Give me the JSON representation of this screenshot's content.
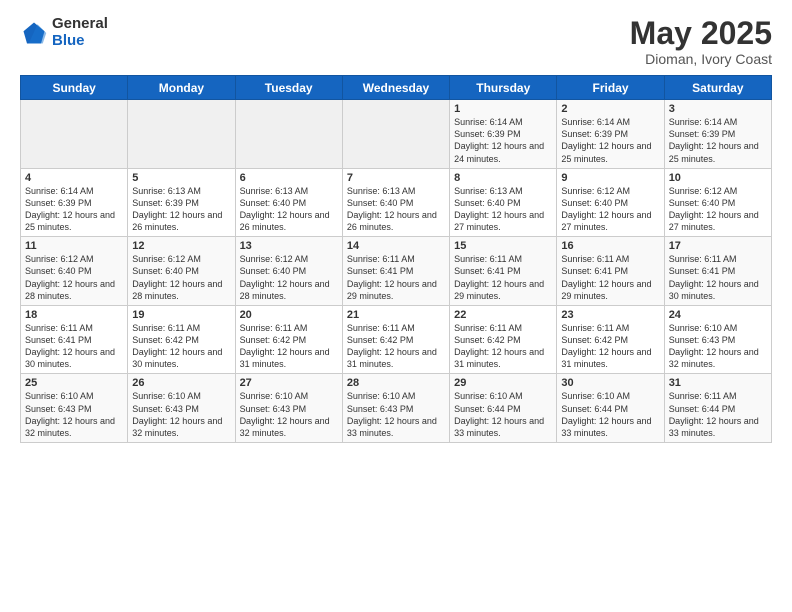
{
  "logo": {
    "general": "General",
    "blue": "Blue"
  },
  "title": "May 2025",
  "location": "Dioman, Ivory Coast",
  "days_header": [
    "Sunday",
    "Monday",
    "Tuesday",
    "Wednesday",
    "Thursday",
    "Friday",
    "Saturday"
  ],
  "weeks": [
    [
      {
        "day": "",
        "info": ""
      },
      {
        "day": "",
        "info": ""
      },
      {
        "day": "",
        "info": ""
      },
      {
        "day": "",
        "info": ""
      },
      {
        "day": "1",
        "info": "Sunrise: 6:14 AM\nSunset: 6:39 PM\nDaylight: 12 hours and 24 minutes."
      },
      {
        "day": "2",
        "info": "Sunrise: 6:14 AM\nSunset: 6:39 PM\nDaylight: 12 hours and 25 minutes."
      },
      {
        "day": "3",
        "info": "Sunrise: 6:14 AM\nSunset: 6:39 PM\nDaylight: 12 hours and 25 minutes."
      }
    ],
    [
      {
        "day": "4",
        "info": "Sunrise: 6:14 AM\nSunset: 6:39 PM\nDaylight: 12 hours and 25 minutes."
      },
      {
        "day": "5",
        "info": "Sunrise: 6:13 AM\nSunset: 6:39 PM\nDaylight: 12 hours and 26 minutes."
      },
      {
        "day": "6",
        "info": "Sunrise: 6:13 AM\nSunset: 6:40 PM\nDaylight: 12 hours and 26 minutes."
      },
      {
        "day": "7",
        "info": "Sunrise: 6:13 AM\nSunset: 6:40 PM\nDaylight: 12 hours and 26 minutes."
      },
      {
        "day": "8",
        "info": "Sunrise: 6:13 AM\nSunset: 6:40 PM\nDaylight: 12 hours and 27 minutes."
      },
      {
        "day": "9",
        "info": "Sunrise: 6:12 AM\nSunset: 6:40 PM\nDaylight: 12 hours and 27 minutes."
      },
      {
        "day": "10",
        "info": "Sunrise: 6:12 AM\nSunset: 6:40 PM\nDaylight: 12 hours and 27 minutes."
      }
    ],
    [
      {
        "day": "11",
        "info": "Sunrise: 6:12 AM\nSunset: 6:40 PM\nDaylight: 12 hours and 28 minutes."
      },
      {
        "day": "12",
        "info": "Sunrise: 6:12 AM\nSunset: 6:40 PM\nDaylight: 12 hours and 28 minutes."
      },
      {
        "day": "13",
        "info": "Sunrise: 6:12 AM\nSunset: 6:40 PM\nDaylight: 12 hours and 28 minutes."
      },
      {
        "day": "14",
        "info": "Sunrise: 6:11 AM\nSunset: 6:41 PM\nDaylight: 12 hours and 29 minutes."
      },
      {
        "day": "15",
        "info": "Sunrise: 6:11 AM\nSunset: 6:41 PM\nDaylight: 12 hours and 29 minutes."
      },
      {
        "day": "16",
        "info": "Sunrise: 6:11 AM\nSunset: 6:41 PM\nDaylight: 12 hours and 29 minutes."
      },
      {
        "day": "17",
        "info": "Sunrise: 6:11 AM\nSunset: 6:41 PM\nDaylight: 12 hours and 30 minutes."
      }
    ],
    [
      {
        "day": "18",
        "info": "Sunrise: 6:11 AM\nSunset: 6:41 PM\nDaylight: 12 hours and 30 minutes."
      },
      {
        "day": "19",
        "info": "Sunrise: 6:11 AM\nSunset: 6:42 PM\nDaylight: 12 hours and 30 minutes."
      },
      {
        "day": "20",
        "info": "Sunrise: 6:11 AM\nSunset: 6:42 PM\nDaylight: 12 hours and 31 minutes."
      },
      {
        "day": "21",
        "info": "Sunrise: 6:11 AM\nSunset: 6:42 PM\nDaylight: 12 hours and 31 minutes."
      },
      {
        "day": "22",
        "info": "Sunrise: 6:11 AM\nSunset: 6:42 PM\nDaylight: 12 hours and 31 minutes."
      },
      {
        "day": "23",
        "info": "Sunrise: 6:11 AM\nSunset: 6:42 PM\nDaylight: 12 hours and 31 minutes."
      },
      {
        "day": "24",
        "info": "Sunrise: 6:10 AM\nSunset: 6:43 PM\nDaylight: 12 hours and 32 minutes."
      }
    ],
    [
      {
        "day": "25",
        "info": "Sunrise: 6:10 AM\nSunset: 6:43 PM\nDaylight: 12 hours and 32 minutes."
      },
      {
        "day": "26",
        "info": "Sunrise: 6:10 AM\nSunset: 6:43 PM\nDaylight: 12 hours and 32 minutes."
      },
      {
        "day": "27",
        "info": "Sunrise: 6:10 AM\nSunset: 6:43 PM\nDaylight: 12 hours and 32 minutes."
      },
      {
        "day": "28",
        "info": "Sunrise: 6:10 AM\nSunset: 6:43 PM\nDaylight: 12 hours and 33 minutes."
      },
      {
        "day": "29",
        "info": "Sunrise: 6:10 AM\nSunset: 6:44 PM\nDaylight: 12 hours and 33 minutes."
      },
      {
        "day": "30",
        "info": "Sunrise: 6:10 AM\nSunset: 6:44 PM\nDaylight: 12 hours and 33 minutes."
      },
      {
        "day": "31",
        "info": "Sunrise: 6:11 AM\nSunset: 6:44 PM\nDaylight: 12 hours and 33 minutes."
      }
    ]
  ]
}
